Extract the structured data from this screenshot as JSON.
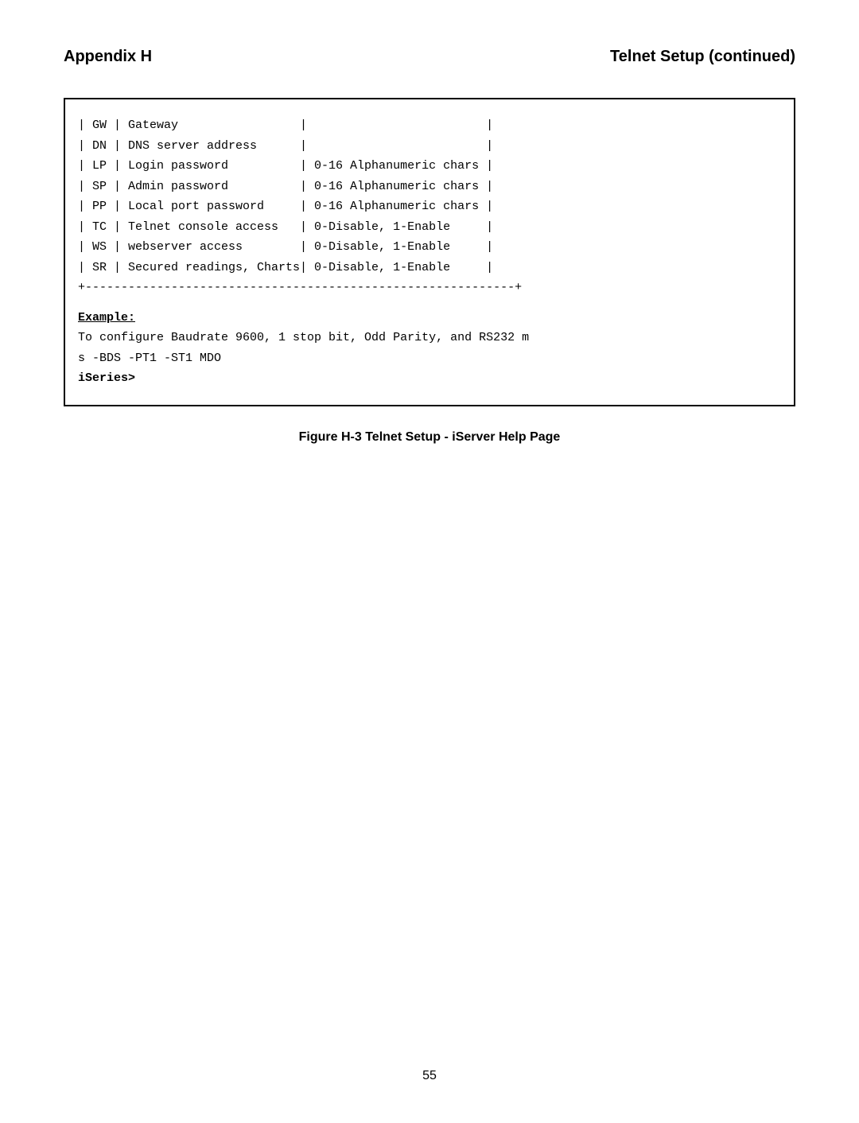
{
  "header": {
    "left": "Appendix  H",
    "right": "Telnet Setup (continued)"
  },
  "table": {
    "rows": [
      {
        "code": "GW",
        "description": "Gateway",
        "value": ""
      },
      {
        "code": "DN",
        "description": "DNS server address",
        "value": ""
      },
      {
        "code": "LP",
        "description": "Login password",
        "value": "0-16 Alphanumeric chars"
      },
      {
        "code": "SP",
        "description": "Admin password",
        "value": "0-16 Alphanumeric chars"
      },
      {
        "code": "PP",
        "description": "Local port password",
        "value": "0-16 Alphanumeric chars"
      },
      {
        "code": "TC",
        "description": "Telnet console access",
        "value": "0-Disable, 1-Enable"
      },
      {
        "code": "WS",
        "description": "webserver access",
        "value": "0-Disable, 1-Enable"
      },
      {
        "code": "SR",
        "description": "Secured readings, Charts",
        "value": "0-Disable, 1-Enable"
      }
    ],
    "divider": "+------------------------------------------------------------+"
  },
  "example": {
    "label": "Example:",
    "line1": "To configure Baudrate 9600, 1 stop bit, Odd Parity, and RS232 m",
    "line2": "s -BDS  -PT1  -ST1  MDO",
    "line3": "iSeries>"
  },
  "figure_caption": "Figure H-3  Telnet Setup - iServer Help Page",
  "page_number": "55"
}
